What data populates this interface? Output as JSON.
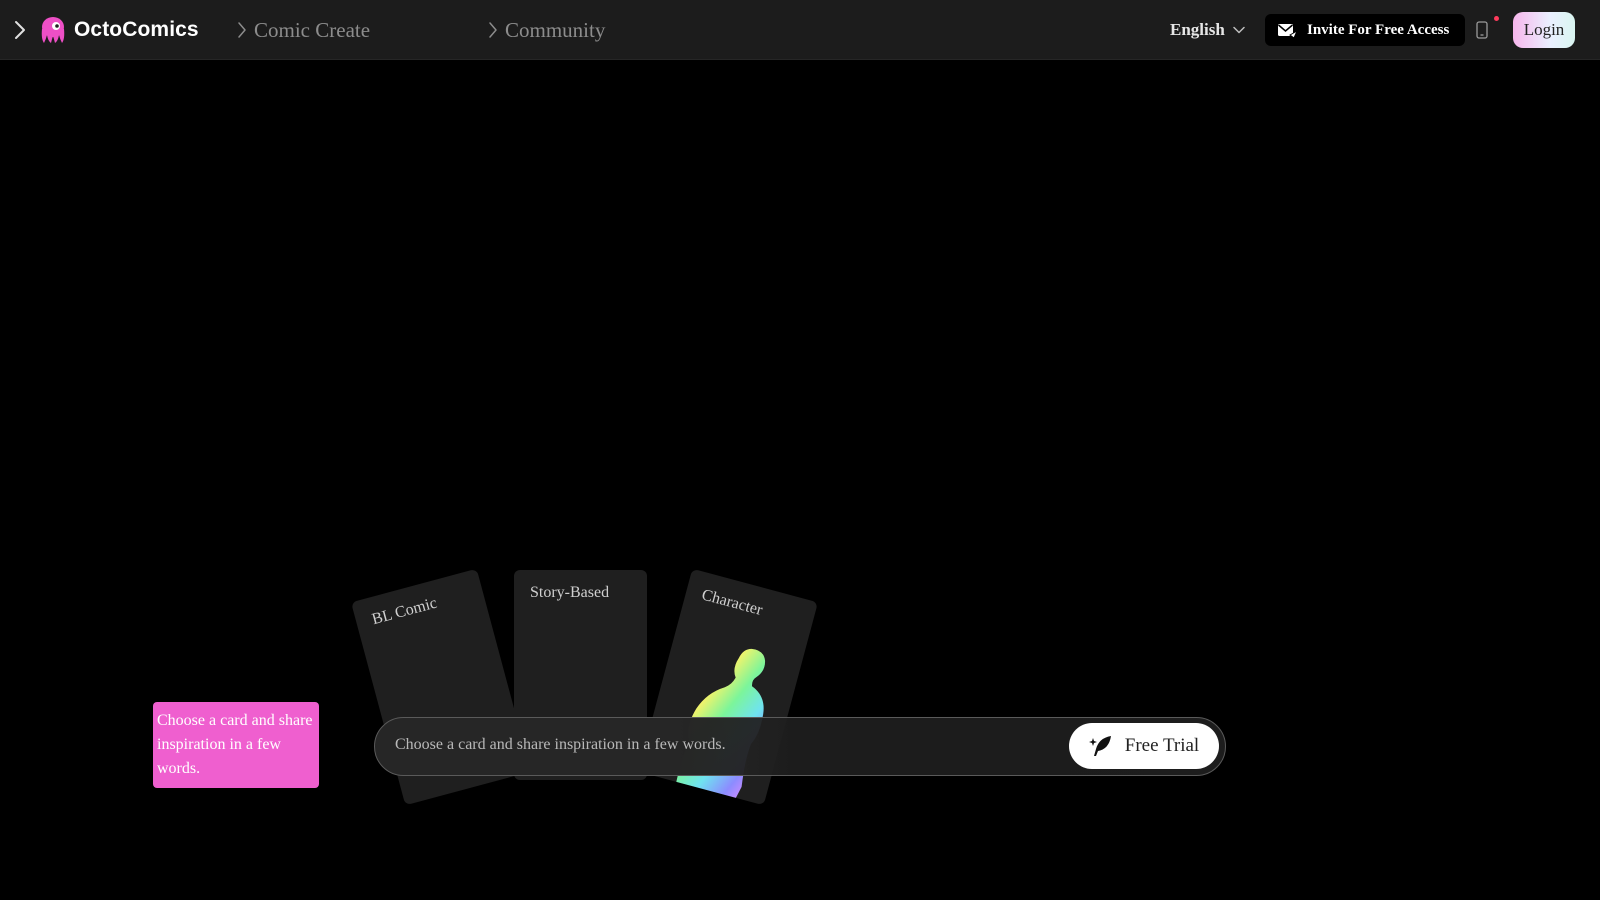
{
  "header": {
    "brand": "OctoComics",
    "nav": [
      {
        "label": "Comic Create"
      },
      {
        "label": "Community"
      }
    ],
    "language": "English",
    "invite_label": "Invite For Free Access",
    "login_label": "Login"
  },
  "cards": [
    {
      "label": "BL Comic"
    },
    {
      "label": "Story-Based"
    },
    {
      "label": "Character"
    }
  ],
  "prompt": {
    "placeholder": "Choose a card and share inspiration in a few words.",
    "button_label": "Free Trial"
  },
  "tooltip": {
    "text": "Choose a card and share inspiration in a few words."
  },
  "colors": {
    "background": "#000000",
    "header": "#1c1c1c",
    "brand_pink": "#ee4fc6",
    "tooltip": "#ef5fcf",
    "card": "#1f1f1f",
    "notification_dot": "#ff3b5c"
  },
  "icons": [
    "chevron-right-icon",
    "octopus-logo-icon",
    "chevron-down-icon",
    "mail-send-icon",
    "mobile-device-icon",
    "quill-pen-icon"
  ]
}
